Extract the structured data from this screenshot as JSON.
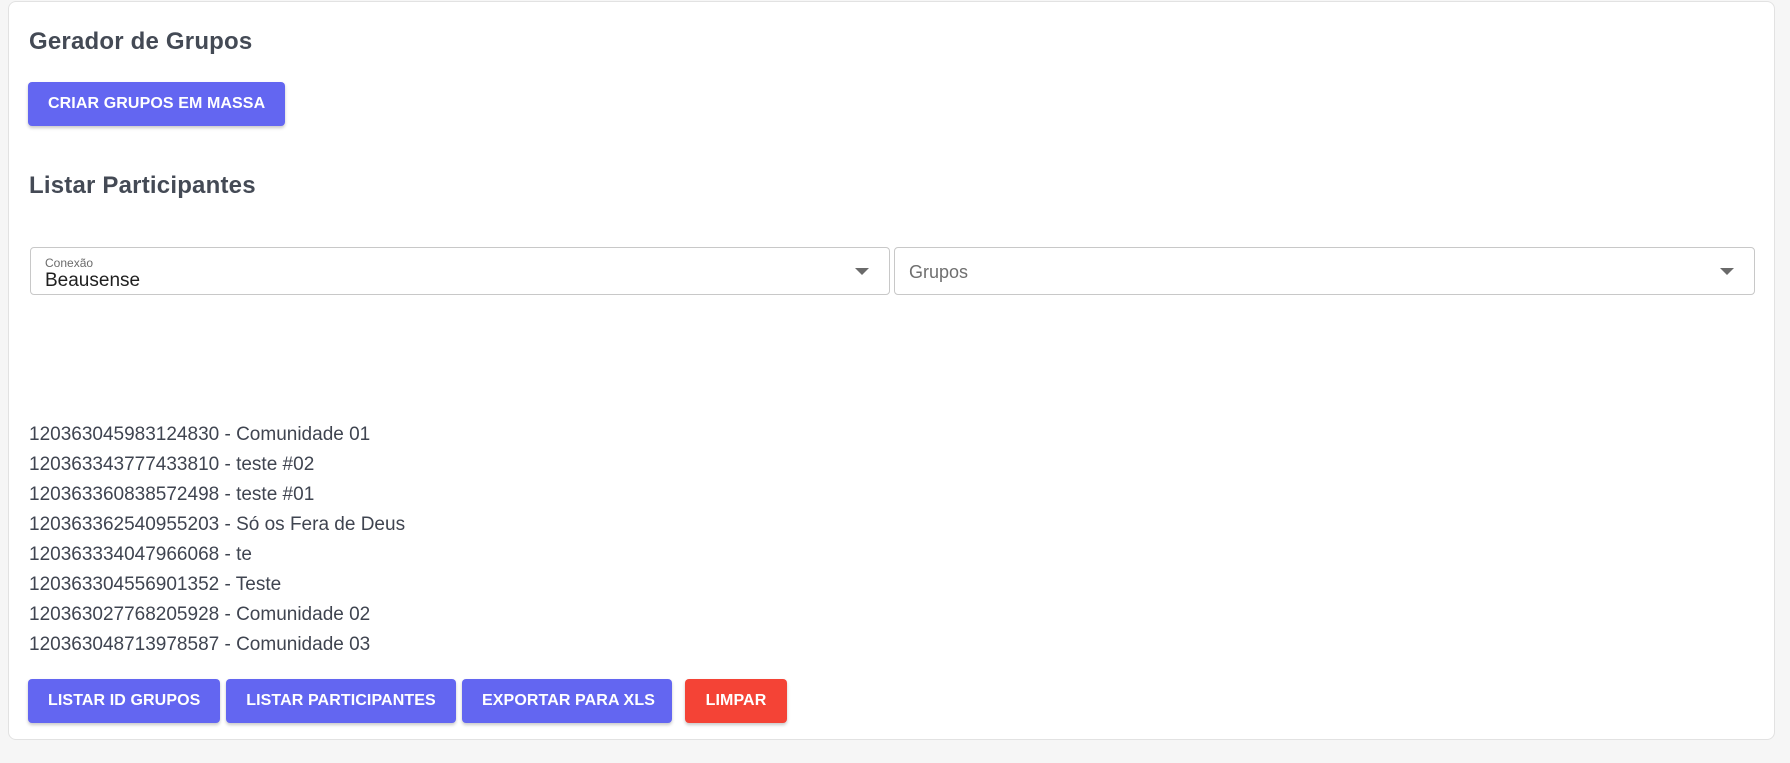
{
  "sections": {
    "generator_title": "Gerador de Grupos",
    "list_title": "Listar Participantes"
  },
  "buttons": {
    "bulk_create": "CRIAR GRUPOS EM MASSA",
    "list_ids": "LISTAR ID GRUPOS",
    "list_participants": "LISTAR PARTICIPANTES",
    "export_xls": "EXPORTAR PARA XLS",
    "clear": "LIMPAR"
  },
  "connection_select": {
    "label": "Conexão",
    "value": "Beausense"
  },
  "groups_select": {
    "placeholder": "Grupos"
  },
  "group_list": [
    "120363045983124830 - Comunidade 01",
    "120363343777433810 - teste #02",
    "120363360838572498 - teste #01",
    "120363362540955203 - Só os Fera de Deus",
    "120363334047966068 - te",
    "120363304556901352 - Teste",
    "120363027768205928 - Comunidade 02",
    "120363048713978587 - Comunidade 03"
  ],
  "colors": {
    "primary": "#6366f1",
    "danger": "#f44336"
  }
}
